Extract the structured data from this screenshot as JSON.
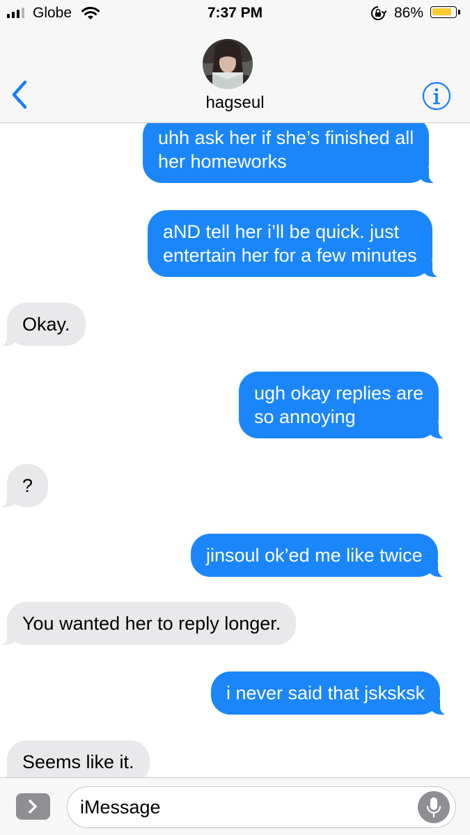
{
  "status_bar": {
    "carrier": "Globe",
    "time": "7:37 PM",
    "battery_percent": "86%",
    "battery_level": 0.86,
    "signal_bars_filled": 3,
    "signal_bars_total": 4,
    "icons": [
      "signal-icon",
      "wifi-icon",
      "rotation-lock-icon",
      "battery-icon"
    ]
  },
  "header": {
    "contact_name": "hagseul",
    "icons": [
      "back-chevron-icon",
      "avatar",
      "info-icon"
    ]
  },
  "messages": [
    {
      "direction": "outgoing",
      "text": "uhh ask her if she’s finished all\nher homeworks"
    },
    {
      "direction": "outgoing",
      "text": "aND tell her i’ll be quick. just\nentertain her for a few minutes"
    },
    {
      "direction": "incoming",
      "text": "Okay."
    },
    {
      "direction": "outgoing",
      "text": "ugh okay replies are\nso annoying"
    },
    {
      "direction": "incoming",
      "text": "?"
    },
    {
      "direction": "outgoing",
      "text": "jinsoul ok’ed me like twice"
    },
    {
      "direction": "incoming",
      "text": "You wanted her to reply longer."
    },
    {
      "direction": "outgoing",
      "text": "i never said that jsksksk"
    },
    {
      "direction": "incoming",
      "text": "Seems like it."
    }
  ],
  "input_bar": {
    "placeholder": "iMessage",
    "icons": [
      "app-drawer-chevron-icon",
      "microphone-icon"
    ]
  },
  "colors": {
    "outgoing_bubble": "#1b86fa",
    "incoming_bubble": "#e9e9eb",
    "accent": "#147efb",
    "battery_fill": "#f7cc2e",
    "bar_background": "#f7f7f7"
  }
}
